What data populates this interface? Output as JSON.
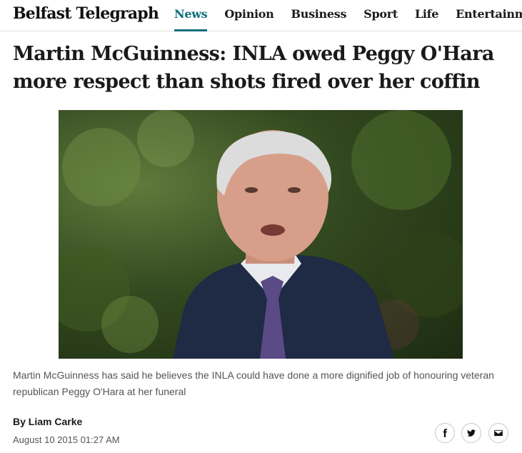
{
  "brand": {
    "logo_text": "Belfast Telegraph",
    "accent_color": "#0b6f7c"
  },
  "nav": {
    "items": [
      {
        "label": "News",
        "active": true
      },
      {
        "label": "Opinion",
        "active": false
      },
      {
        "label": "Business",
        "active": false
      },
      {
        "label": "Sport",
        "active": false
      },
      {
        "label": "Life",
        "active": false
      },
      {
        "label": "Entertainment",
        "active": false
      }
    ]
  },
  "article": {
    "headline": "Martin McGuinness: INLA owed Peggy O'Hara more respect than shots fired over her coffin",
    "caption": "Martin McGuinness has said he believes the INLA could have done a more dignified job of honouring veteran republican Peggy O'Hara at her funeral",
    "byline": "By Liam Carke",
    "date": "August 10 2015 01:27 AM"
  },
  "share": {
    "icons": [
      "facebook-icon",
      "twitter-icon",
      "email-icon"
    ]
  }
}
